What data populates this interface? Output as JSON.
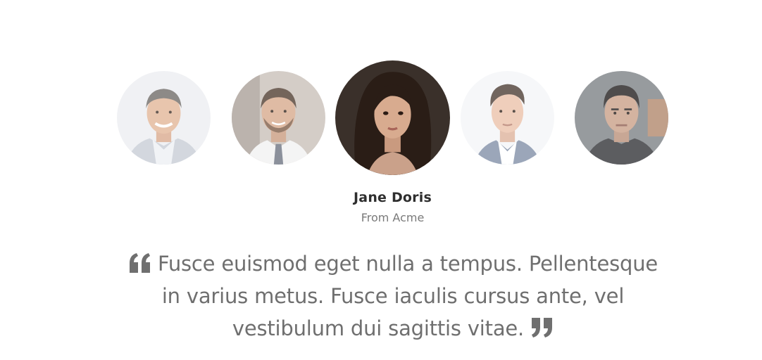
{
  "testimonial": {
    "name": "Jane Doris",
    "company": "From Acme",
    "quote": "Fusce euismod eget nulla a tempus. Pellentesque in varius metus. Fusce iaculis cursus ante, vel vestibulum dui sagittis vitae."
  },
  "avatars": [
    {
      "icon": "person-avatar-1",
      "active": false
    },
    {
      "icon": "person-avatar-2",
      "active": false
    },
    {
      "icon": "person-avatar-3",
      "active": true
    },
    {
      "icon": "person-avatar-4",
      "active": false
    },
    {
      "icon": "person-avatar-5",
      "active": false
    }
  ],
  "icons": {
    "open_quote": "quote-open-icon",
    "close_quote": "quote-close-icon"
  },
  "colors": {
    "name": "#2e2e2e",
    "company": "#7a7a7a",
    "quote_text": "#6f6f6f",
    "quote_icon": "#6f6f6f"
  }
}
